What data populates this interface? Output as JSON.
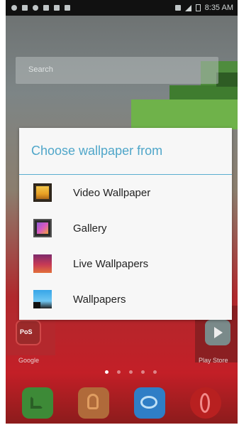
{
  "status_bar": {
    "time": "8:35 AM"
  },
  "search": {
    "placeholder": "Search"
  },
  "dialog": {
    "title": "Choose wallpaper from",
    "items": [
      {
        "label": "Video Wallpaper",
        "icon": "video-wallpaper-icon"
      },
      {
        "label": "Gallery",
        "icon": "gallery-icon"
      },
      {
        "label": "Live Wallpapers",
        "icon": "live-wallpapers-icon"
      },
      {
        "label": "Wallpapers",
        "icon": "wallpapers-icon"
      }
    ]
  },
  "home": {
    "left_app_label": "Google",
    "left_app_badge": "PoS",
    "right_app_label": "Play Store",
    "page_count": 5,
    "active_page": 1
  },
  "dock": [
    "phone-icon",
    "contacts-icon",
    "messaging-icon",
    "browser-icon"
  ],
  "colors": {
    "dialog_title": "#4fa6c9",
    "dialog_divider": "#5aaed0",
    "dialog_bg": "#f7f7f7"
  }
}
